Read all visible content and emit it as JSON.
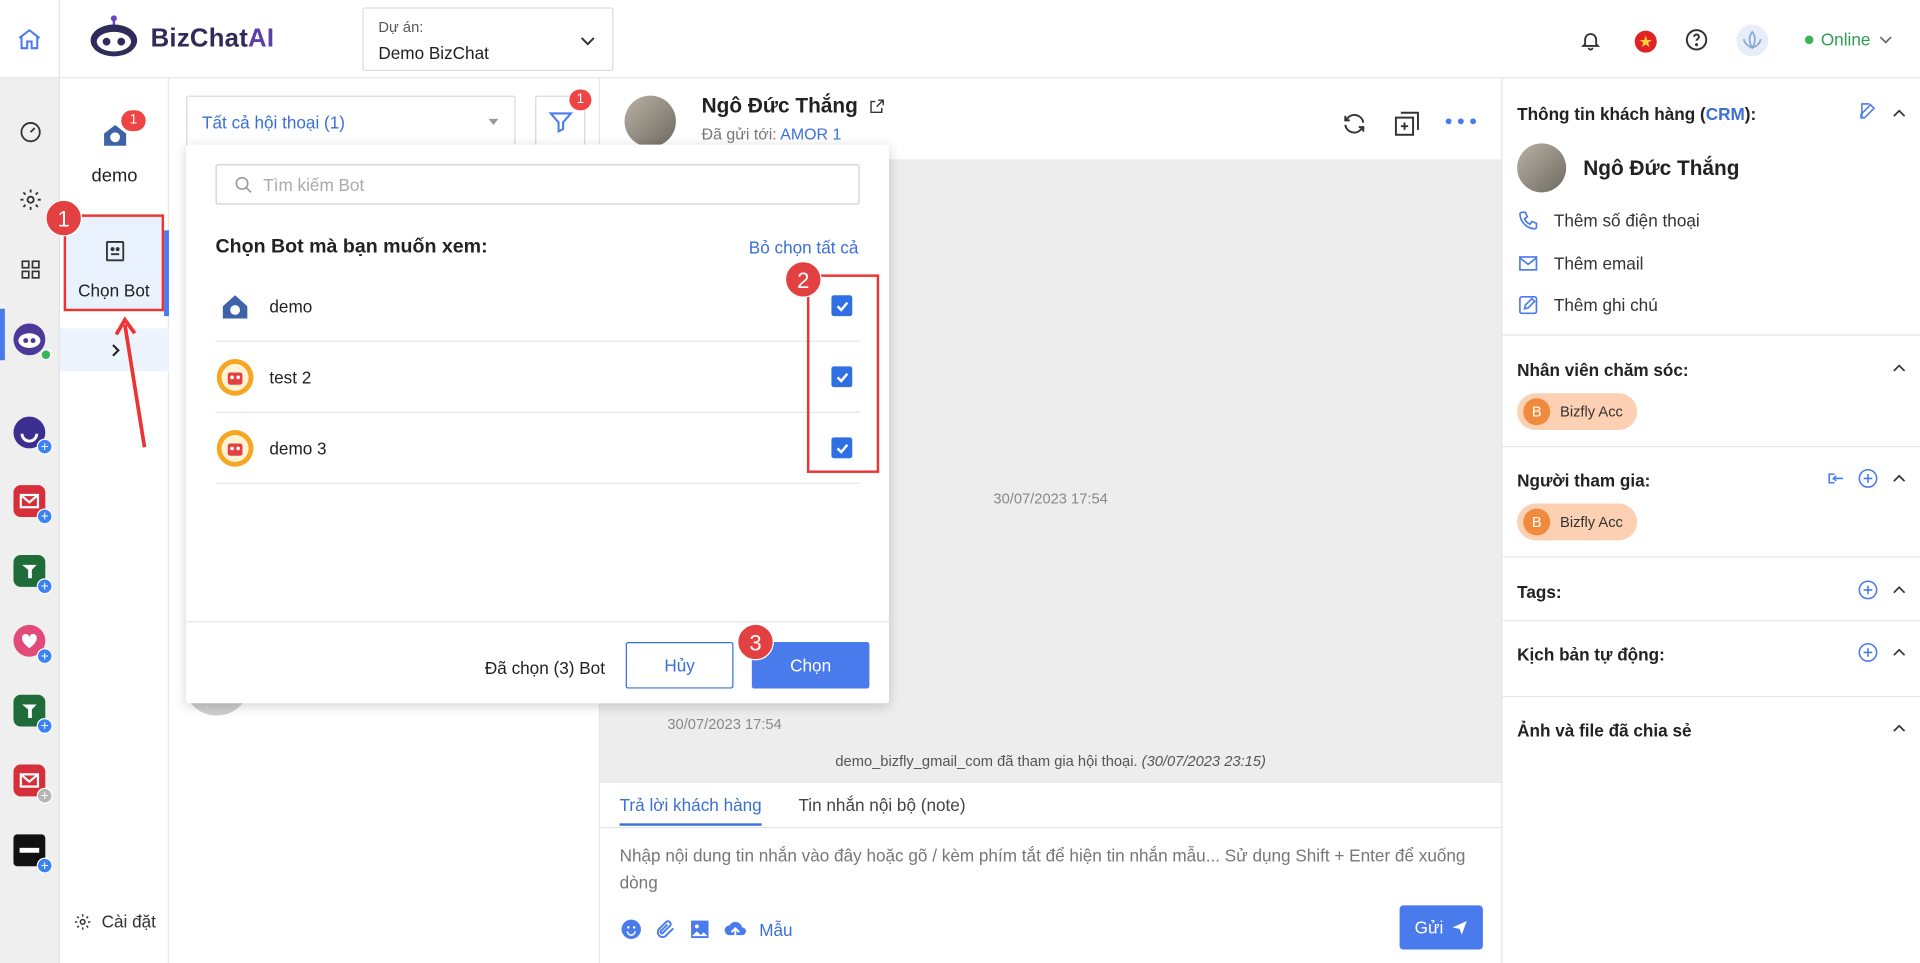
{
  "brand": {
    "name_left": "BizChat",
    "name_right": "AI"
  },
  "project": {
    "label": "Dự án:",
    "value": "Demo BizChat"
  },
  "header": {
    "status": "Online"
  },
  "bots_column": {
    "bot_name": "demo",
    "bot_badge": "1",
    "choose_bot_label": "Chọn Bot",
    "settings_label": "Cài đặt"
  },
  "list": {
    "filter_value": "Tất cả hội thoại (1)",
    "filter_badge": "1"
  },
  "popup": {
    "search_placeholder": "Tìm kiếm Bot",
    "title": "Chọn Bot mà bạn muốn xem:",
    "deselect_all": "Bỏ chọn tất cả",
    "bots": [
      {
        "name": "demo",
        "checked": true
      },
      {
        "name": "test 2",
        "checked": true
      },
      {
        "name": "demo 3",
        "checked": true
      }
    ],
    "selected_count": "Đã chọn (3) Bot",
    "cancel": "Hủy",
    "confirm": "Chọn"
  },
  "steps": [
    "1",
    "2",
    "3"
  ],
  "chat": {
    "contact_name": "Ngô Đức Thắng",
    "sent_to_label": "Đã gửi tới:",
    "sent_to_value": "AMOR 1",
    "timestamp_center": "30/07/2023 17:54",
    "timestamp_msg": "30/07/2023 17:54",
    "join_notice": "demo_bizfly_gmail_com đã tham gia hội thoại.",
    "join_time": "(30/07/2023 23:15)",
    "tab_reply": "Trả lời khách hàng",
    "tab_internal": "Tin nhắn nội bộ (note)",
    "composer_placeholder": "Nhập nội dung tin nhắn vào đây hoặc gõ / kèm phím tắt để hiện tin nhắn mẫu... Sử dụng Shift + Enter để xuống dòng",
    "template_label": "Mẫu",
    "send_label": "Gửi"
  },
  "crm": {
    "title_prefix": "Thông tin khách hàng (",
    "title_link": "CRM",
    "title_suffix": "):",
    "customer_name": "Ngô Đức Thắng",
    "add_phone": "Thêm số điện thoại",
    "add_email": "Thêm email",
    "add_note": "Thêm ghi chú",
    "staff_title": "Nhân viên chăm sóc:",
    "staff_chip_initial": "B",
    "staff_chip": "Bizfly Acc",
    "participants_title": "Người tham gia:",
    "participant_chip_initial": "B",
    "participant_chip": "Bizfly Acc",
    "tags_title": "Tags:",
    "automation_title": "Kịch bản tự động:",
    "files_title": "Ảnh và file đã chia sẻ"
  },
  "colors": {
    "accent": "#3b6fd9",
    "primary_button": "#4a7bed",
    "highlight": "#e33333",
    "online": "#3cb45a"
  }
}
